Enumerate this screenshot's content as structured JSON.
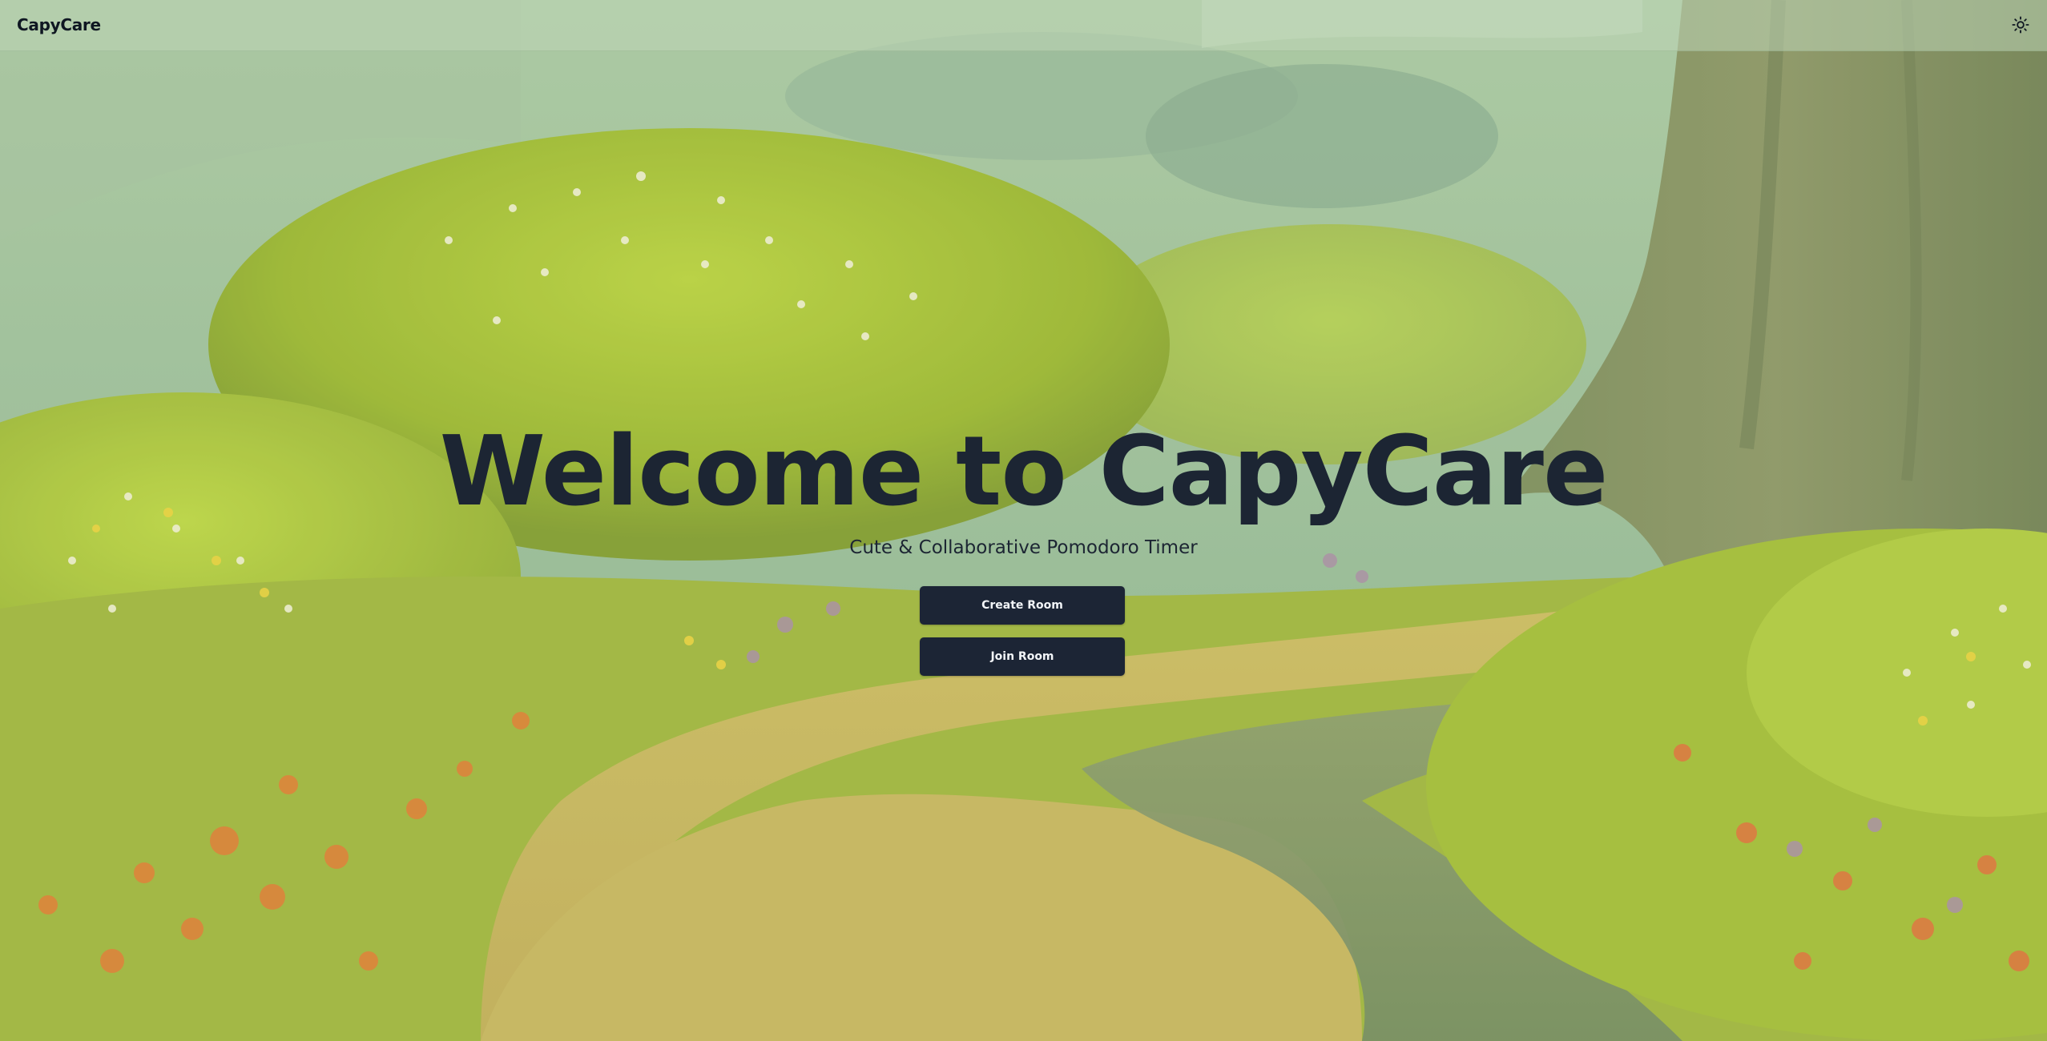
{
  "navbar": {
    "brand": "CapyCare",
    "theme_toggle_icon": "sun-icon"
  },
  "hero": {
    "title": "Welcome to CapyCare",
    "subtitle": "Cute & Collaborative Pomodoro Timer",
    "create_room_label": "Create Room",
    "join_room_label": "Join Room"
  },
  "colors": {
    "button_bg": "#1c2535",
    "text_dark": "#1c2533",
    "navbar_bg": "#bed6b6"
  }
}
